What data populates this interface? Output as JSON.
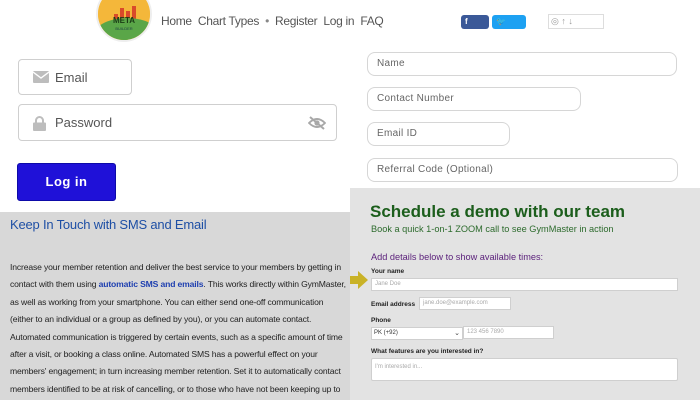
{
  "header": {
    "logo_text": "META",
    "logo_subtext": "BUILDER",
    "nav": [
      "Home",
      "Chart Types",
      "•",
      "Register",
      "Log in",
      "FAQ"
    ]
  },
  "social": {
    "share_label": "Share",
    "tweet_label": "Tweet"
  },
  "login": {
    "email_label": "Email",
    "password_label": "Password",
    "button_label": "Log in"
  },
  "signup_form": {
    "name_placeholder": "Name",
    "contact_placeholder": "Contact Number",
    "email_placeholder": "Email ID",
    "referral_placeholder": "Referral Code (Optional)"
  },
  "sms": {
    "title": "Keep In Touch with SMS and Email",
    "body_pre": "Increase your member retention and deliver the best service to your members by getting in contact with them using ",
    "body_link": "automatic SMS and emails",
    "body_post": ". This works directly within GymMaster, as well as working from your smartphone. You can either send one-off communication (either to an individual or a group as defined by you), or you can automate contact. Automated communication is triggered by certain events, such as a specific amount of time after a visit, or booking a class online. Automated SMS has a powerful effect on your members' engagement; in turn increasing member retention. Set it to automatically contact members identified to be at risk of cancelling, or to those who have not been keeping up to date with their payments."
  },
  "demo": {
    "title": "Schedule a demo with our team",
    "subtitle": "Book a quick 1-on-1 ZOOM call to see GymMaster in action",
    "instructions": "Add details below to show available times:",
    "name_label": "Your name",
    "name_placeholder": "Jane Doe",
    "email_label": "Email address",
    "email_placeholder": "jane.doe@example.com",
    "phone_label": "Phone",
    "country_value": "PK (+92)",
    "phone_placeholder": "123 456 7890",
    "features_label": "What features are you interested in?",
    "features_placeholder": "I'm interested in..."
  },
  "colors": {
    "login_button": "#1f11d8",
    "sms_title": "#1e4fa5",
    "demo_title": "#1c5e1c",
    "demo_instructions": "#5a1f7a",
    "arrow_marker": "#c9b227"
  }
}
